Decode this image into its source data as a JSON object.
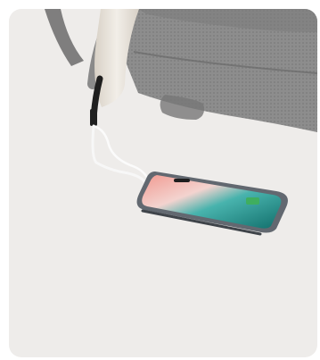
{
  "image": {
    "subject": "backpack-charging-phone",
    "icons": [
      "backpack-icon",
      "charging-cable-icon",
      "smartphone-icon"
    ],
    "colors": {
      "background": "#eeecea",
      "backpack_mesh": "#8c8c8c",
      "backpack_dark": "#6f6f6f",
      "strap_cream": "#e7e1d8",
      "cable": "#f7f7f7",
      "phone_frame": "#5b5f66",
      "screen_top": "#f08a86",
      "screen_sea": "#1f8b86",
      "widget_green": "#3fae5f"
    }
  }
}
